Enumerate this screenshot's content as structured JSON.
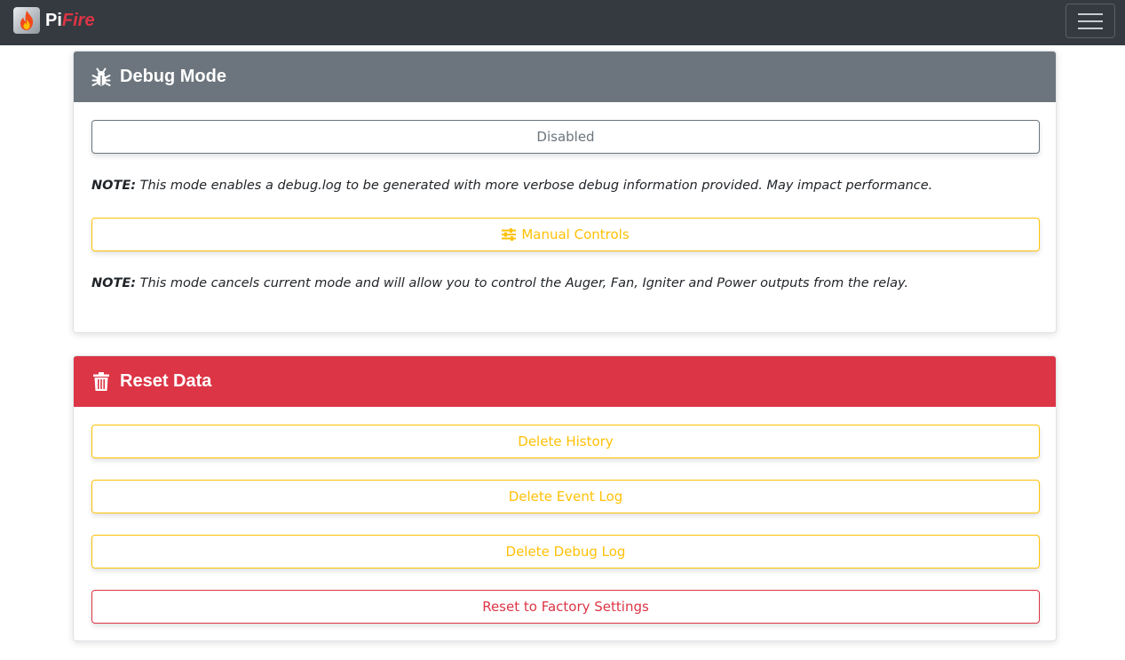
{
  "navbar": {
    "brand_pi": "Pi",
    "brand_fire": "Fire",
    "logo_icon": "flame-icon",
    "menu_icon": "hamburger-icon"
  },
  "debug_card": {
    "title": "Debug Mode",
    "icon": "bug-icon",
    "header_color": "#6c757d",
    "status_button": "Disabled",
    "note1_label": "NOTE:",
    "note1_text": "This mode enables a debug.log to be generated with more verbose debug information provided. May impact performance.",
    "manual_button": "Manual Controls",
    "manual_icon": "sliders-icon",
    "note2_label": "NOTE:",
    "note2_text": "This mode cancels current mode and will allow you to control the Auger, Fan, Igniter and Power outputs from the relay."
  },
  "reset_card": {
    "title": "Reset Data",
    "icon": "trash-icon",
    "header_color": "#dc3545",
    "buttons": [
      {
        "label": "Delete History"
      },
      {
        "label": "Delete Event Log"
      },
      {
        "label": "Delete Debug Log"
      },
      {
        "label": "Reset to Factory Settings"
      }
    ]
  },
  "colors": {
    "navbar": "#343a40",
    "warning": "#ffc107",
    "danger": "#dc3545",
    "secondary": "#6c757d"
  }
}
